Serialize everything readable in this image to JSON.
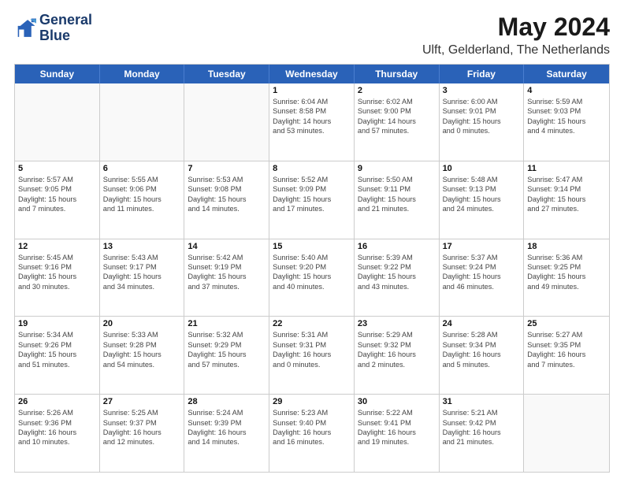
{
  "logo": {
    "line1": "General",
    "line2": "Blue"
  },
  "title": "May 2024",
  "subtitle": "Ulft, Gelderland, The Netherlands",
  "header_days": [
    "Sunday",
    "Monday",
    "Tuesday",
    "Wednesday",
    "Thursday",
    "Friday",
    "Saturday"
  ],
  "weeks": [
    [
      {
        "day": "",
        "lines": []
      },
      {
        "day": "",
        "lines": []
      },
      {
        "day": "",
        "lines": []
      },
      {
        "day": "1",
        "lines": [
          "Sunrise: 6:04 AM",
          "Sunset: 8:58 PM",
          "Daylight: 14 hours",
          "and 53 minutes."
        ]
      },
      {
        "day": "2",
        "lines": [
          "Sunrise: 6:02 AM",
          "Sunset: 9:00 PM",
          "Daylight: 14 hours",
          "and 57 minutes."
        ]
      },
      {
        "day": "3",
        "lines": [
          "Sunrise: 6:00 AM",
          "Sunset: 9:01 PM",
          "Daylight: 15 hours",
          "and 0 minutes."
        ]
      },
      {
        "day": "4",
        "lines": [
          "Sunrise: 5:59 AM",
          "Sunset: 9:03 PM",
          "Daylight: 15 hours",
          "and 4 minutes."
        ]
      }
    ],
    [
      {
        "day": "5",
        "lines": [
          "Sunrise: 5:57 AM",
          "Sunset: 9:05 PM",
          "Daylight: 15 hours",
          "and 7 minutes."
        ]
      },
      {
        "day": "6",
        "lines": [
          "Sunrise: 5:55 AM",
          "Sunset: 9:06 PM",
          "Daylight: 15 hours",
          "and 11 minutes."
        ]
      },
      {
        "day": "7",
        "lines": [
          "Sunrise: 5:53 AM",
          "Sunset: 9:08 PM",
          "Daylight: 15 hours",
          "and 14 minutes."
        ]
      },
      {
        "day": "8",
        "lines": [
          "Sunrise: 5:52 AM",
          "Sunset: 9:09 PM",
          "Daylight: 15 hours",
          "and 17 minutes."
        ]
      },
      {
        "day": "9",
        "lines": [
          "Sunrise: 5:50 AM",
          "Sunset: 9:11 PM",
          "Daylight: 15 hours",
          "and 21 minutes."
        ]
      },
      {
        "day": "10",
        "lines": [
          "Sunrise: 5:48 AM",
          "Sunset: 9:13 PM",
          "Daylight: 15 hours",
          "and 24 minutes."
        ]
      },
      {
        "day": "11",
        "lines": [
          "Sunrise: 5:47 AM",
          "Sunset: 9:14 PM",
          "Daylight: 15 hours",
          "and 27 minutes."
        ]
      }
    ],
    [
      {
        "day": "12",
        "lines": [
          "Sunrise: 5:45 AM",
          "Sunset: 9:16 PM",
          "Daylight: 15 hours",
          "and 30 minutes."
        ]
      },
      {
        "day": "13",
        "lines": [
          "Sunrise: 5:43 AM",
          "Sunset: 9:17 PM",
          "Daylight: 15 hours",
          "and 34 minutes."
        ]
      },
      {
        "day": "14",
        "lines": [
          "Sunrise: 5:42 AM",
          "Sunset: 9:19 PM",
          "Daylight: 15 hours",
          "and 37 minutes."
        ]
      },
      {
        "day": "15",
        "lines": [
          "Sunrise: 5:40 AM",
          "Sunset: 9:20 PM",
          "Daylight: 15 hours",
          "and 40 minutes."
        ]
      },
      {
        "day": "16",
        "lines": [
          "Sunrise: 5:39 AM",
          "Sunset: 9:22 PM",
          "Daylight: 15 hours",
          "and 43 minutes."
        ]
      },
      {
        "day": "17",
        "lines": [
          "Sunrise: 5:37 AM",
          "Sunset: 9:24 PM",
          "Daylight: 15 hours",
          "and 46 minutes."
        ]
      },
      {
        "day": "18",
        "lines": [
          "Sunrise: 5:36 AM",
          "Sunset: 9:25 PM",
          "Daylight: 15 hours",
          "and 49 minutes."
        ]
      }
    ],
    [
      {
        "day": "19",
        "lines": [
          "Sunrise: 5:34 AM",
          "Sunset: 9:26 PM",
          "Daylight: 15 hours",
          "and 51 minutes."
        ]
      },
      {
        "day": "20",
        "lines": [
          "Sunrise: 5:33 AM",
          "Sunset: 9:28 PM",
          "Daylight: 15 hours",
          "and 54 minutes."
        ]
      },
      {
        "day": "21",
        "lines": [
          "Sunrise: 5:32 AM",
          "Sunset: 9:29 PM",
          "Daylight: 15 hours",
          "and 57 minutes."
        ]
      },
      {
        "day": "22",
        "lines": [
          "Sunrise: 5:31 AM",
          "Sunset: 9:31 PM",
          "Daylight: 16 hours",
          "and 0 minutes."
        ]
      },
      {
        "day": "23",
        "lines": [
          "Sunrise: 5:29 AM",
          "Sunset: 9:32 PM",
          "Daylight: 16 hours",
          "and 2 minutes."
        ]
      },
      {
        "day": "24",
        "lines": [
          "Sunrise: 5:28 AM",
          "Sunset: 9:34 PM",
          "Daylight: 16 hours",
          "and 5 minutes."
        ]
      },
      {
        "day": "25",
        "lines": [
          "Sunrise: 5:27 AM",
          "Sunset: 9:35 PM",
          "Daylight: 16 hours",
          "and 7 minutes."
        ]
      }
    ],
    [
      {
        "day": "26",
        "lines": [
          "Sunrise: 5:26 AM",
          "Sunset: 9:36 PM",
          "Daylight: 16 hours",
          "and 10 minutes."
        ]
      },
      {
        "day": "27",
        "lines": [
          "Sunrise: 5:25 AM",
          "Sunset: 9:37 PM",
          "Daylight: 16 hours",
          "and 12 minutes."
        ]
      },
      {
        "day": "28",
        "lines": [
          "Sunrise: 5:24 AM",
          "Sunset: 9:39 PM",
          "Daylight: 16 hours",
          "and 14 minutes."
        ]
      },
      {
        "day": "29",
        "lines": [
          "Sunrise: 5:23 AM",
          "Sunset: 9:40 PM",
          "Daylight: 16 hours",
          "and 16 minutes."
        ]
      },
      {
        "day": "30",
        "lines": [
          "Sunrise: 5:22 AM",
          "Sunset: 9:41 PM",
          "Daylight: 16 hours",
          "and 19 minutes."
        ]
      },
      {
        "day": "31",
        "lines": [
          "Sunrise: 5:21 AM",
          "Sunset: 9:42 PM",
          "Daylight: 16 hours",
          "and 21 minutes."
        ]
      },
      {
        "day": "",
        "lines": []
      }
    ]
  ]
}
